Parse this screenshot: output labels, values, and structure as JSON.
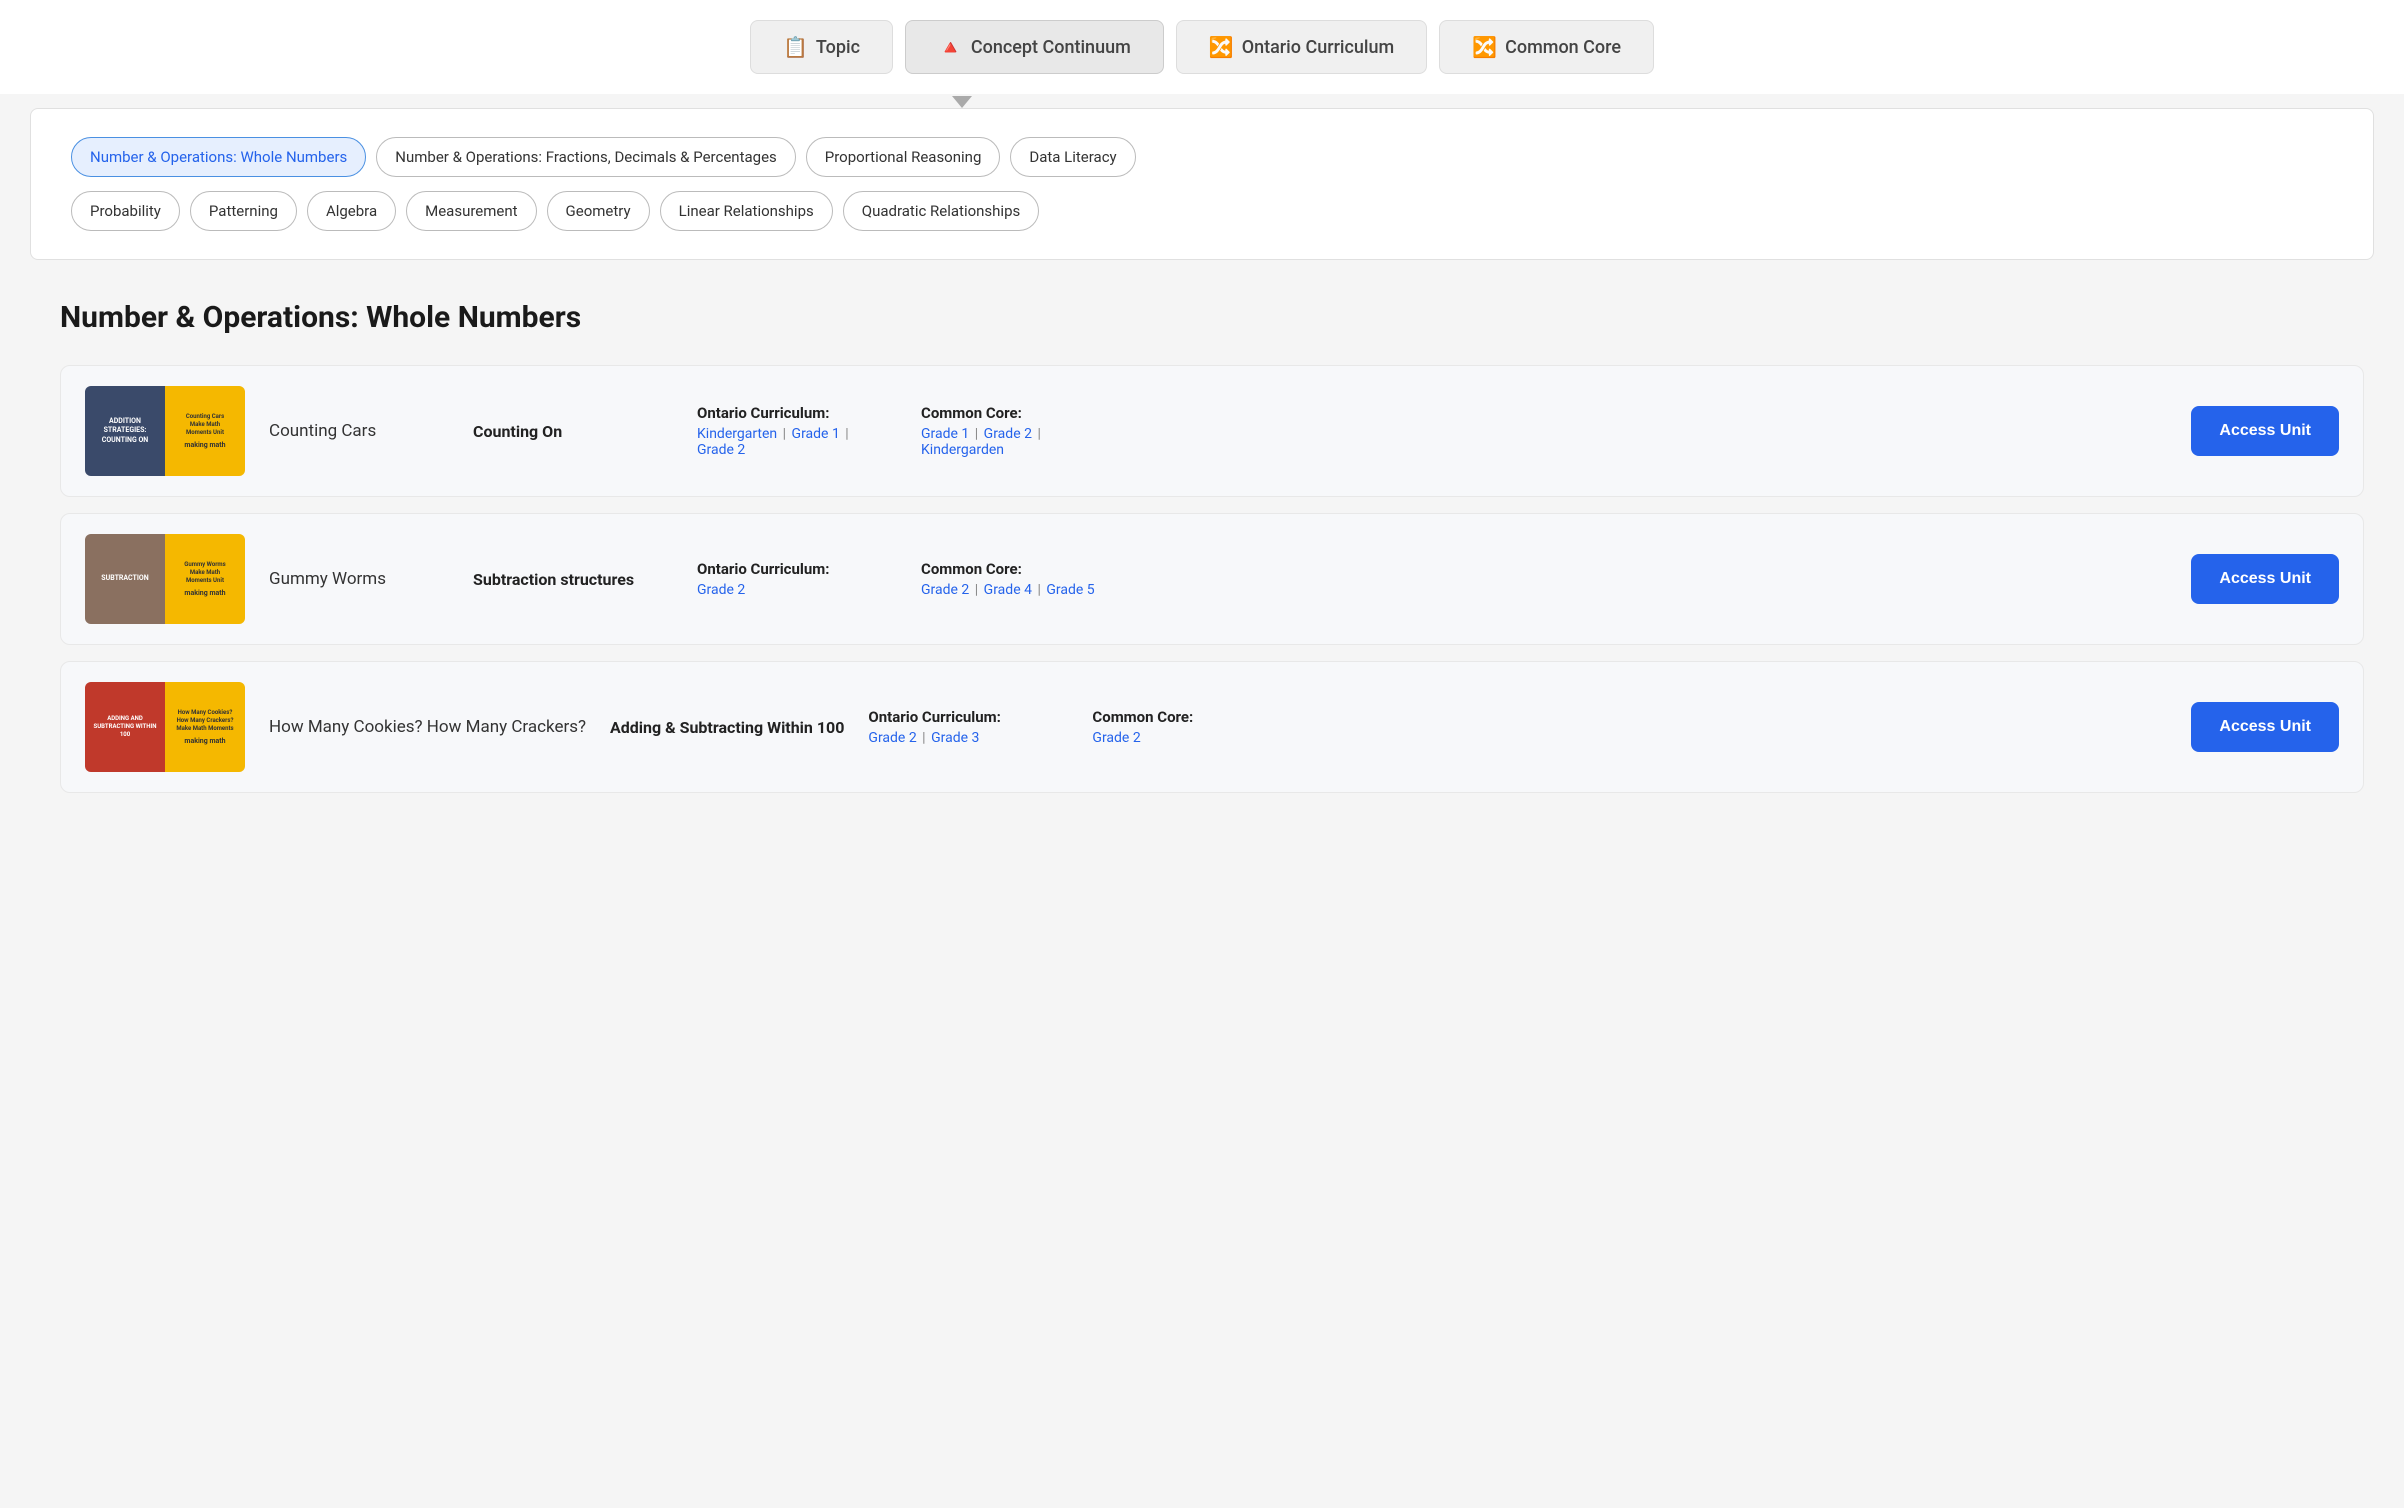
{
  "tabs": [
    {
      "id": "topic",
      "label": "Topic",
      "icon": "📋",
      "active": false
    },
    {
      "id": "concept-continuum",
      "label": "Concept Continuum",
      "icon": "🔺",
      "active": true
    },
    {
      "id": "ontario-curriculum",
      "label": "Ontario Curriculum",
      "icon": "🔀",
      "active": false
    },
    {
      "id": "common-core",
      "label": "Common Core",
      "icon": "🔀",
      "active": false
    }
  ],
  "filter": {
    "row1": [
      {
        "id": "whole-numbers",
        "label": "Number & Operations: Whole Numbers",
        "selected": true
      },
      {
        "id": "fractions",
        "label": "Number & Operations: Fractions, Decimals & Percentages",
        "selected": false
      },
      {
        "id": "proportional",
        "label": "Proportional Reasoning",
        "selected": false
      },
      {
        "id": "data-literacy",
        "label": "Data Literacy",
        "selected": false
      }
    ],
    "row2": [
      {
        "id": "probability",
        "label": "Probability",
        "selected": false
      },
      {
        "id": "patterning",
        "label": "Patterning",
        "selected": false
      },
      {
        "id": "algebra",
        "label": "Algebra",
        "selected": false
      },
      {
        "id": "measurement",
        "label": "Measurement",
        "selected": false
      },
      {
        "id": "geometry",
        "label": "Geometry",
        "selected": false
      },
      {
        "id": "linear",
        "label": "Linear Relationships",
        "selected": false
      },
      {
        "id": "quadratic",
        "label": "Quadratic Relationships",
        "selected": false
      }
    ]
  },
  "section_title": "Number & Operations: Whole Numbers",
  "units": [
    {
      "id": "counting-cars",
      "name": "Counting Cars",
      "concept": "Counting On",
      "ontario_label": "Ontario Curriculum:",
      "ontario_links": [
        {
          "text": "Kindergarten",
          "href": "#"
        },
        {
          "text": "Grade 1",
          "href": "#"
        },
        {
          "text": "Grade 2",
          "href": "#"
        }
      ],
      "common_core_label": "Common Core:",
      "common_core_links": [
        {
          "text": "Grade 1",
          "href": "#"
        },
        {
          "text": "Grade 2",
          "href": "#"
        },
        {
          "text": "Kindergarden",
          "href": "#"
        }
      ],
      "access_label": "Access Unit",
      "thumb_left_bg": "#4a7fc1",
      "thumb_left_text": "ADDITION STRATEGIES: COUNTING ON",
      "thumb_right_title": "Counting Cars",
      "thumb_right_sub": "Make Math Moments Unit"
    },
    {
      "id": "gummy-worms",
      "name": "Gummy Worms",
      "concept": "Subtraction structures",
      "ontario_label": "Ontario Curriculum:",
      "ontario_links": [
        {
          "text": "Grade 2",
          "href": "#"
        }
      ],
      "common_core_label": "Common Core:",
      "common_core_links": [
        {
          "text": "Grade 2",
          "href": "#"
        },
        {
          "text": "Grade 4",
          "href": "#"
        },
        {
          "text": "Grade 5",
          "href": "#"
        }
      ],
      "access_label": "Access Unit",
      "thumb_left_bg": "#7a6a5a",
      "thumb_left_text": "SUBTRACTION",
      "thumb_right_title": "Gummy Worms",
      "thumb_right_sub": "Make Math Moments Unit"
    },
    {
      "id": "cookies-crackers",
      "name": "How Many Cookies? How Many Crackers?",
      "concept": "Adding & Subtracting Within 100",
      "ontario_label": "Ontario Curriculum:",
      "ontario_links": [
        {
          "text": "Grade 2",
          "href": "#"
        },
        {
          "text": "Grade 3",
          "href": "#"
        }
      ],
      "common_core_label": "Common Core:",
      "common_core_links": [
        {
          "text": "Grade 2",
          "href": "#"
        }
      ],
      "access_label": "Access Unit",
      "thumb_left_bg": "#c0392b",
      "thumb_left_text": "ADDING AND SUBTRACTING WITHIN 100",
      "thumb_right_title": "How Many Cookies? How Many Crackers?",
      "thumb_right_sub": "Make Math Moments Unit"
    }
  ]
}
